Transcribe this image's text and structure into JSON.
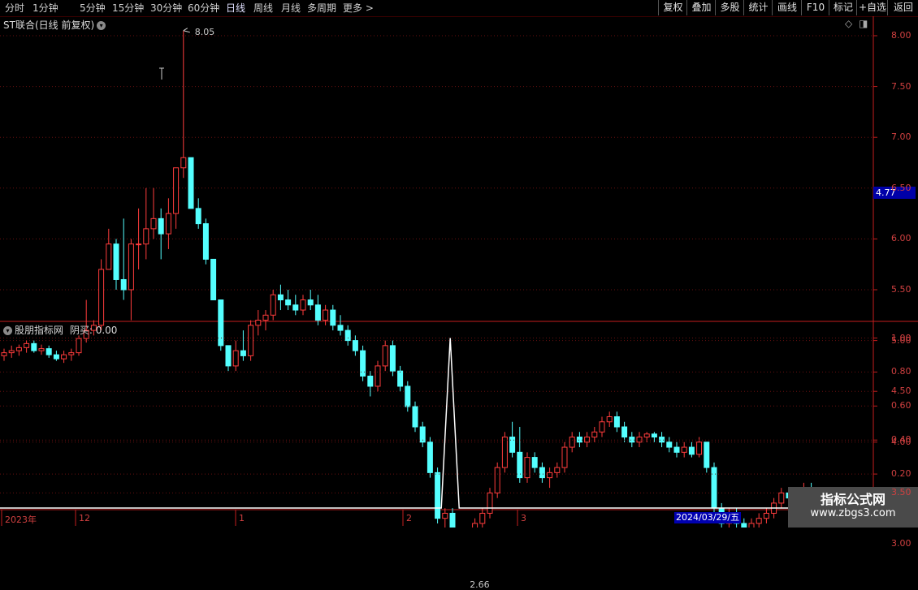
{
  "toolbar": {
    "periods": [
      "分时",
      "1分钟",
      "5分钟",
      "15分钟",
      "30分钟",
      "60分钟",
      "日线",
      "周线",
      "月线",
      "多周期",
      "更多 >"
    ],
    "active_period": "日线",
    "buttons": [
      "复权",
      "叠加",
      "多股",
      "统计",
      "画线",
      "F10",
      "标记",
      "+自选",
      "返回"
    ]
  },
  "main_chart": {
    "title": "ST联合(日线 前复权)",
    "price_ticks": [
      "8.00",
      "7.50",
      "7.00",
      "6.50",
      "6.00",
      "5.50",
      "5.00",
      "4.50",
      "4.00",
      "3.50",
      "3.00"
    ],
    "current_price": "4.77",
    "high_label": "8.05",
    "low_label": "2.66",
    "up_color": "#ff3c3c",
    "down_color": "#54ffff"
  },
  "indicator": {
    "title": "股朋指标网",
    "value_label": "阴买: 0.00",
    "ticks": [
      "1.00",
      "0.80",
      "0.60",
      "0.40",
      "0.20"
    ]
  },
  "x_axis": {
    "labels": [
      "2023年",
      "12",
      "1",
      "2",
      "3"
    ],
    "highlighted_date": "2024/03/29/五"
  },
  "watermark": {
    "line1": "指标公式网",
    "line2": "www.zbgs3.com"
  },
  "chart_data": [
    {
      "type": "candlestick",
      "title": "ST联合(日线 前复权)",
      "ylim": [
        2.5,
        8.2
      ],
      "yticks": [
        3.0,
        3.5,
        4.0,
        4.5,
        5.0,
        5.5,
        6.0,
        6.5,
        7.0,
        7.5,
        8.0
      ],
      "high": 8.05,
      "low": 2.66,
      "last": 4.77,
      "ohlc": [
        [
          4.85,
          4.92,
          4.8,
          4.88
        ],
        [
          4.88,
          4.95,
          4.83,
          4.9
        ],
        [
          4.9,
          4.96,
          4.85,
          4.93
        ],
        [
          4.93,
          5.0,
          4.88,
          4.97
        ],
        [
          4.97,
          5.0,
          4.88,
          4.9
        ],
        [
          4.9,
          4.96,
          4.86,
          4.92
        ],
        [
          4.92,
          4.95,
          4.83,
          4.86
        ],
        [
          4.86,
          4.9,
          4.8,
          4.82
        ],
        [
          4.82,
          4.9,
          4.78,
          4.86
        ],
        [
          4.86,
          4.92,
          4.8,
          4.88
        ],
        [
          4.88,
          5.05,
          4.85,
          5.02
        ],
        [
          5.02,
          5.4,
          4.98,
          5.1
        ],
        [
          5.1,
          5.2,
          5.05,
          5.15
        ],
        [
          5.15,
          5.8,
          5.1,
          5.7
        ],
        [
          5.7,
          6.1,
          5.8,
          5.95
        ],
        [
          5.95,
          6.0,
          5.5,
          5.6
        ],
        [
          5.6,
          6.2,
          5.4,
          5.5
        ],
        [
          5.5,
          6.0,
          5.2,
          5.95
        ],
        [
          5.95,
          6.3,
          5.7,
          5.95
        ],
        [
          5.95,
          6.5,
          5.8,
          6.1
        ],
        [
          6.1,
          6.5,
          6.0,
          6.2
        ],
        [
          6.2,
          6.3,
          5.8,
          6.05
        ],
        [
          6.05,
          6.4,
          5.9,
          6.25
        ],
        [
          6.25,
          6.7,
          6.1,
          6.7
        ],
        [
          6.7,
          8.05,
          6.6,
          6.8
        ],
        [
          6.8,
          6.5,
          6.3,
          6.3
        ],
        [
          6.3,
          6.4,
          6.1,
          6.15
        ],
        [
          6.15,
          6.2,
          5.75,
          5.8
        ],
        [
          5.8,
          5.7,
          5.4,
          5.4
        ],
        [
          5.4,
          5.2,
          4.9,
          4.95
        ],
        [
          4.95,
          4.95,
          4.7,
          4.75
        ],
        [
          4.75,
          5.0,
          4.7,
          4.9
        ],
        [
          4.9,
          5.1,
          4.8,
          4.85
        ],
        [
          4.85,
          5.2,
          4.8,
          5.15
        ],
        [
          5.15,
          5.3,
          5.05,
          5.2
        ],
        [
          5.2,
          5.3,
          5.1,
          5.25
        ],
        [
          5.25,
          5.5,
          5.2,
          5.45
        ],
        [
          5.45,
          5.55,
          5.3,
          5.4
        ],
        [
          5.4,
          5.5,
          5.3,
          5.35
        ],
        [
          5.35,
          5.45,
          5.25,
          5.3
        ],
        [
          5.3,
          5.45,
          5.25,
          5.4
        ],
        [
          5.4,
          5.5,
          5.3,
          5.35
        ],
        [
          5.35,
          5.45,
          5.15,
          5.2
        ],
        [
          5.2,
          5.35,
          5.15,
          5.3
        ],
        [
          5.3,
          5.35,
          5.1,
          5.15
        ],
        [
          5.15,
          5.25,
          5.05,
          5.1
        ],
        [
          5.1,
          5.15,
          4.95,
          5.0
        ],
        [
          5.0,
          5.05,
          4.85,
          4.9
        ],
        [
          4.9,
          4.95,
          4.6,
          4.65
        ],
        [
          4.65,
          4.7,
          4.45,
          4.55
        ],
        [
          4.55,
          4.8,
          4.5,
          4.75
        ],
        [
          4.75,
          5.0,
          4.7,
          4.95
        ],
        [
          4.95,
          5.0,
          4.65,
          4.7
        ],
        [
          4.7,
          4.75,
          4.5,
          4.55
        ],
        [
          4.55,
          4.6,
          4.3,
          4.35
        ],
        [
          4.35,
          4.4,
          4.1,
          4.15
        ],
        [
          4.15,
          4.2,
          3.95,
          4.0
        ],
        [
          4.0,
          4.05,
          3.65,
          3.7
        ],
        [
          3.7,
          3.75,
          3.2,
          3.25
        ],
        [
          3.25,
          3.35,
          3.05,
          3.3
        ],
        [
          3.3,
          3.35,
          2.95,
          3.0
        ],
        [
          3.0,
          3.05,
          2.66,
          2.75
        ],
        [
          2.75,
          3.1,
          2.7,
          3.05
        ],
        [
          3.05,
          3.25,
          3.0,
          3.2
        ],
        [
          3.2,
          3.35,
          3.1,
          3.3
        ],
        [
          3.3,
          3.55,
          3.25,
          3.5
        ],
        [
          3.5,
          3.8,
          3.45,
          3.75
        ],
        [
          3.75,
          4.1,
          3.7,
          4.05
        ],
        [
          4.05,
          4.2,
          3.85,
          3.9
        ],
        [
          3.9,
          4.15,
          3.6,
          3.65
        ],
        [
          3.65,
          3.9,
          3.6,
          3.85
        ],
        [
          3.85,
          3.9,
          3.7,
          3.75
        ],
        [
          3.75,
          3.8,
          3.6,
          3.65
        ],
        [
          3.65,
          3.75,
          3.55,
          3.7
        ],
        [
          3.7,
          3.8,
          3.65,
          3.75
        ],
        [
          3.75,
          4.0,
          3.7,
          3.95
        ],
        [
          3.95,
          4.1,
          3.9,
          4.05
        ],
        [
          4.05,
          4.1,
          3.95,
          4.0
        ],
        [
          4.0,
          4.1,
          3.95,
          4.05
        ],
        [
          4.05,
          4.15,
          4.0,
          4.1
        ],
        [
          4.1,
          4.25,
          4.05,
          4.2
        ],
        [
          4.2,
          4.3,
          4.15,
          4.25
        ],
        [
          4.25,
          4.3,
          4.1,
          4.15
        ],
        [
          4.15,
          4.2,
          4.0,
          4.05
        ],
        [
          4.05,
          4.1,
          3.95,
          4.0
        ],
        [
          4.0,
          4.1,
          3.95,
          4.05
        ],
        [
          4.05,
          4.1,
          4.0,
          4.08
        ],
        [
          4.08,
          4.1,
          4.0,
          4.05
        ],
        [
          4.05,
          4.1,
          3.95,
          4.0
        ],
        [
          4.0,
          4.05,
          3.9,
          3.95
        ],
        [
          3.95,
          4.0,
          3.85,
          3.9
        ],
        [
          3.9,
          4.0,
          3.85,
          3.95
        ],
        [
          3.95,
          4.0,
          3.85,
          3.88
        ],
        [
          3.88,
          4.05,
          3.85,
          4.0
        ],
        [
          4.0,
          4.0,
          3.7,
          3.75
        ],
        [
          3.75,
          3.8,
          3.3,
          3.35
        ],
        [
          3.35,
          3.4,
          3.15,
          3.2
        ],
        [
          3.2,
          3.35,
          3.15,
          3.3
        ],
        [
          3.3,
          3.35,
          3.15,
          3.2
        ],
        [
          3.2,
          3.25,
          3.1,
          3.15
        ],
        [
          3.15,
          3.25,
          3.1,
          3.2
        ],
        [
          3.2,
          3.3,
          3.15,
          3.25
        ],
        [
          3.25,
          3.35,
          3.2,
          3.3
        ],
        [
          3.3,
          3.45,
          3.25,
          3.4
        ],
        [
          3.4,
          3.55,
          3.35,
          3.5
        ],
        [
          3.5,
          3.55,
          3.4,
          3.45
        ],
        [
          3.45,
          3.55,
          3.4,
          3.5
        ],
        [
          3.5,
          3.6,
          3.45,
          3.55
        ],
        [
          3.55,
          3.6,
          3.45,
          3.5
        ],
        [
          3.5,
          3.55,
          3.4,
          3.45
        ],
        [
          3.45,
          3.5,
          3.4,
          3.48
        ],
        [
          3.48,
          3.5,
          3.35,
          3.38
        ]
      ]
    },
    {
      "type": "line",
      "title": "股朋指标网",
      "series": [
        {
          "name": "阴买",
          "spike_index": 61,
          "spike_value": 1.0,
          "baseline": 0.0
        }
      ],
      "ylim": [
        0,
        1.05
      ],
      "yticks": [
        0.2,
        0.4,
        0.6,
        0.8,
        1.0
      ]
    }
  ]
}
